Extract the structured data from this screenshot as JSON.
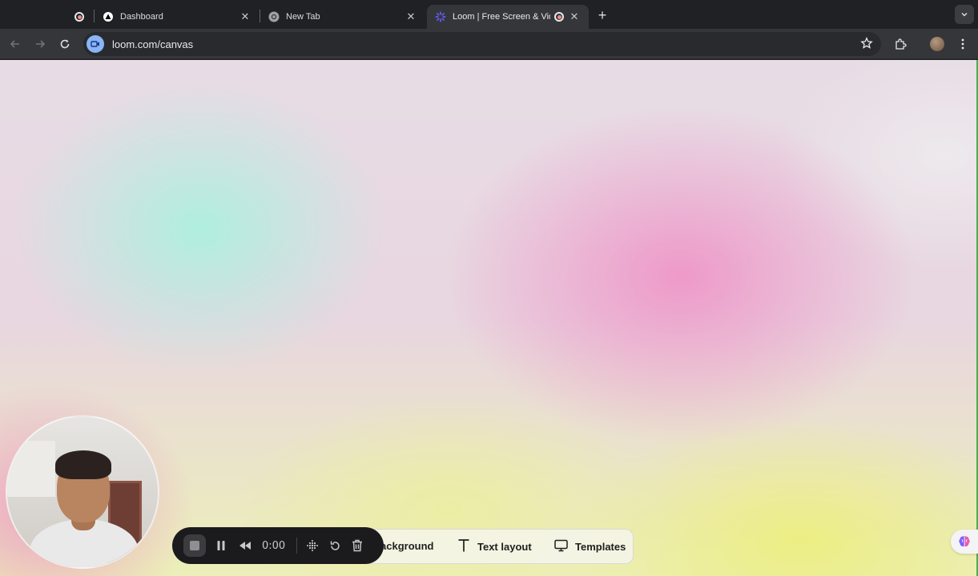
{
  "browser": {
    "tabs": [
      {
        "title": "",
        "icon": "recording-icon",
        "active": false
      },
      {
        "title": "Dashboard",
        "icon": "vercel-triangle-icon",
        "active": false
      },
      {
        "title": "New Tab",
        "icon": "chrome-icon",
        "active": false
      },
      {
        "title": "Loom | Free Screen & Vide",
        "icon": "loom-icon",
        "active": true
      }
    ],
    "url": "loom.com/canvas"
  },
  "recorder": {
    "timer": "0:00"
  },
  "options": {
    "background_label": "ackground",
    "text_layout_label": "Text layout",
    "templates_label": "Templates"
  },
  "colors": {
    "tab_strip": "#202124",
    "toolbar": "#35363a",
    "control_bar": "#1b1b1d",
    "loom_accent": "#625df5"
  }
}
